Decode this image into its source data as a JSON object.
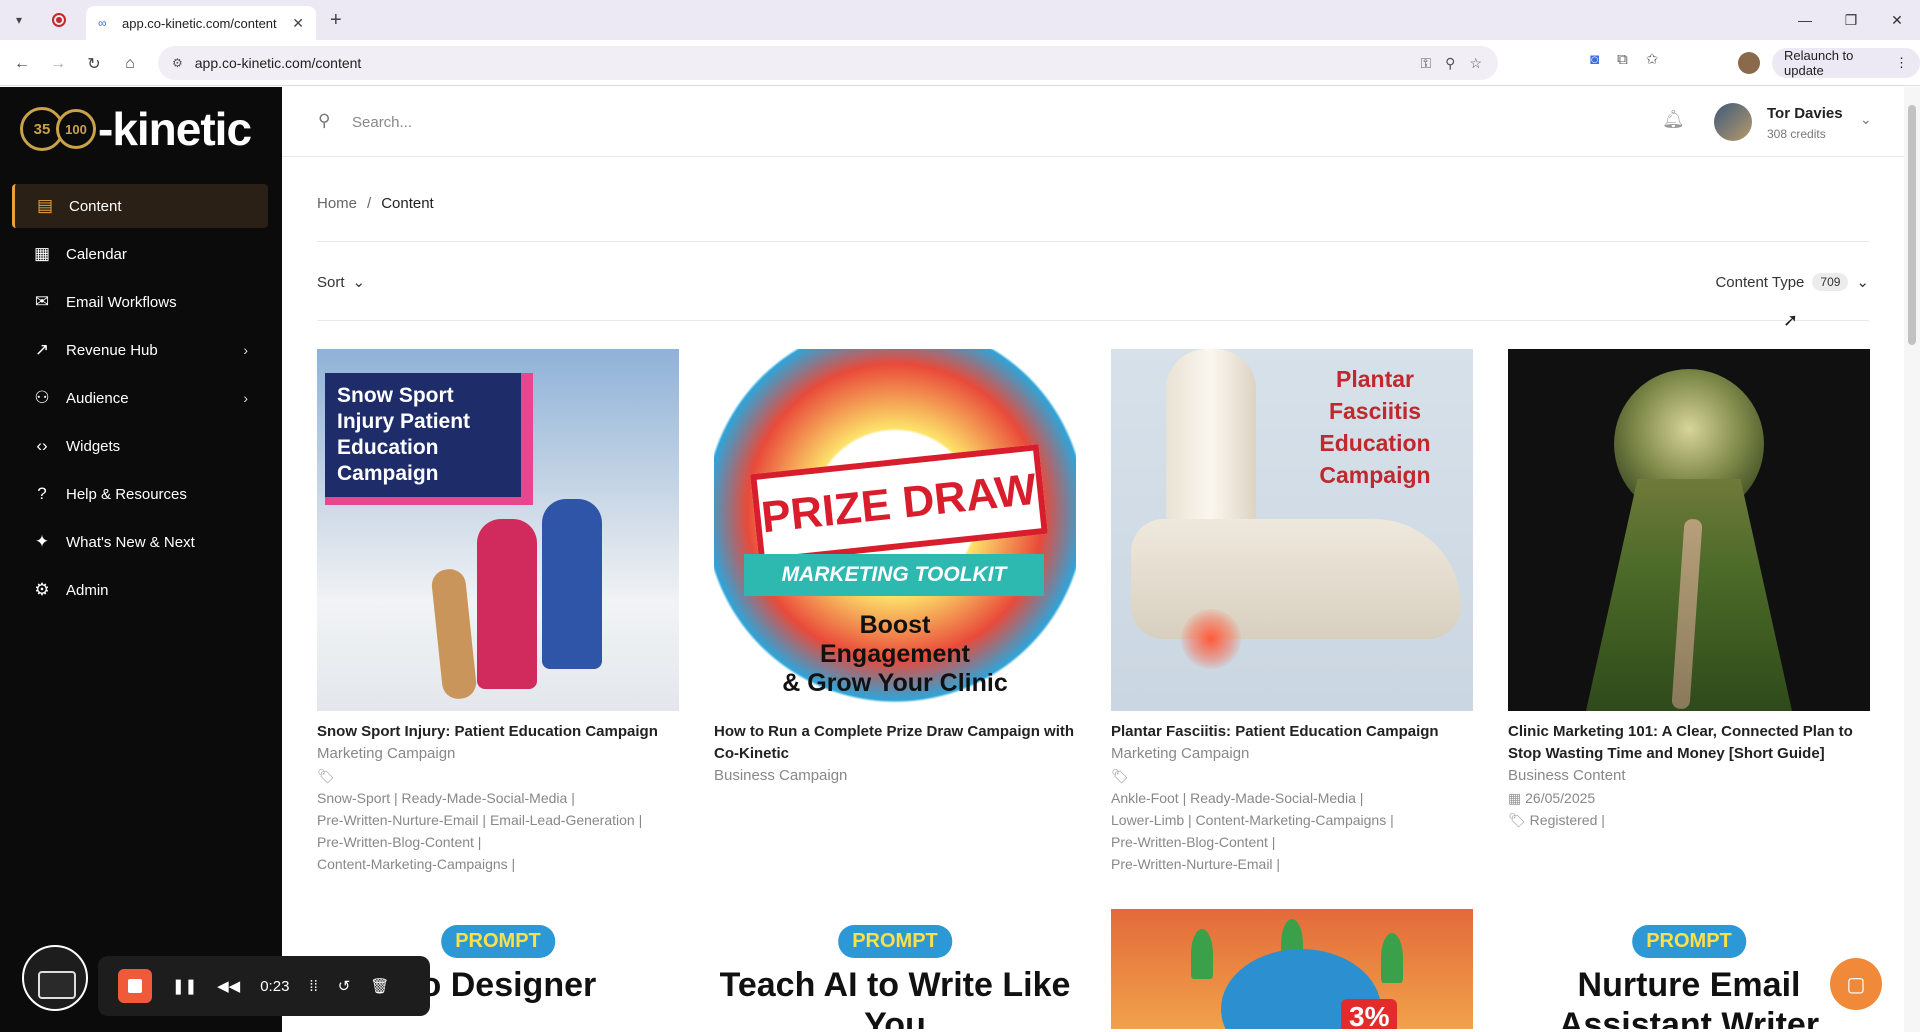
{
  "browser": {
    "tab_title": "app.co-kinetic.com/content",
    "url": "app.co-kinetic.com/content",
    "relaunch_label": "Relaunch to update"
  },
  "sidebar": {
    "brand": "-kinetic",
    "logo_badge_a": "35",
    "logo_badge_b": "100",
    "items": [
      {
        "label": "Content",
        "icon": "document-icon",
        "active": true
      },
      {
        "label": "Calendar",
        "icon": "calendar-icon"
      },
      {
        "label": "Email Workflows",
        "icon": "mail-icon"
      },
      {
        "label": "Revenue Hub",
        "icon": "trend-icon",
        "has_children": true
      },
      {
        "label": "Audience",
        "icon": "user-icon",
        "has_children": true
      },
      {
        "label": "Widgets",
        "icon": "code-icon"
      },
      {
        "label": "Help & Resources",
        "icon": "help-icon"
      },
      {
        "label": "What's New & Next",
        "icon": "sparkle-icon"
      },
      {
        "label": "Admin",
        "icon": "gear-icon"
      }
    ]
  },
  "topbar": {
    "search_placeholder": "Search...",
    "user_name": "Tor Davies",
    "user_credits": "308 credits"
  },
  "breadcrumb": {
    "home": "Home",
    "separator": "/",
    "current": "Content"
  },
  "toolbar": {
    "sort_label": "Sort",
    "content_type_label": "Content Type",
    "content_type_count": "709"
  },
  "cards": [
    {
      "title": "Snow Sport Injury: Patient Education Campaign",
      "type": "Marketing Campaign",
      "thumb_text": "Snow Sport Injury Patient Education Campaign",
      "tags": [
        "Snow-Sport | Ready-Made-Social-Media |",
        "Pre-Written-Nurture-Email | Email-Lead-Generation |",
        "Pre-Written-Blog-Content |",
        "Content-Marketing-Campaigns |"
      ]
    },
    {
      "title": "How to Run a Complete Prize Draw Campaign with Co-Kinetic",
      "type": "Business Campaign",
      "thumb_main": "PRIZE DRAW",
      "thumb_banner": "MARKETING TOOLKIT",
      "thumb_line1": "Boost",
      "thumb_line2": "Engagement",
      "thumb_line3": "& Grow Your Clinic"
    },
    {
      "title": "Plantar Fasciitis: Patient Education Campaign",
      "type": "Marketing Campaign",
      "thumb_text": "Plantar Fasciitis Education Campaign",
      "tags": [
        "Ankle-Foot | Ready-Made-Social-Media |",
        "Lower-Limb | Content-Marketing-Campaigns |",
        "Pre-Written-Blog-Content |",
        "Pre-Written-Nurture-Email |"
      ]
    },
    {
      "title": "Clinic Marketing 101: A Clear, Connected Plan to Stop Wasting Time and Money [Short Guide]",
      "type": "Business Content",
      "date": "26/05/2025",
      "tags": [
        "Registered |"
      ]
    }
  ],
  "row2": [
    {
      "pill": "PROMPT",
      "title": "go Designer"
    },
    {
      "pill": "PROMPT",
      "title": "Teach AI to Write Like You"
    },
    {
      "pct": "3%"
    },
    {
      "pill": "PROMPT",
      "title": "Nurture Email Assistant Writer"
    }
  ],
  "recorder": {
    "time": "0:23"
  },
  "colors": {
    "accent": "#e8a33a",
    "sidebar_bg": "#0b0b0b",
    "chat": "#f08a3a"
  }
}
